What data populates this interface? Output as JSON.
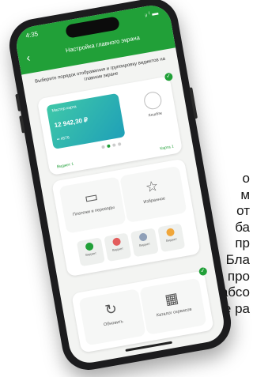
{
  "side_text": [
    "о",
    "м",
    "от",
    "ба",
    "пр",
    "Бла",
    "про",
    "абсо",
    "не ра"
  ],
  "status": {
    "time": "4:35",
    "indicators": "ᵢₗ ⁽ ▬"
  },
  "header": {
    "back_icon": "back-arrow-icon",
    "title": "Настройка главного экрана"
  },
  "subtitle": "Выберите порядок отображения и группировку виджетов на главном экране",
  "card_block": {
    "card_label": "Мастер карта",
    "card_amount": "12 942,30 ₽",
    "card_number": "•• 4576",
    "side_label": "Кешбэк",
    "foot_left": "Виджет 1",
    "foot_right": "Карта 1"
  },
  "tiles": [
    {
      "label": "Платежи и переводы",
      "icon": "card-icon"
    },
    {
      "label": "Избранное",
      "icon": "star-icon"
    }
  ],
  "minis": [
    {
      "label": "Виджет",
      "color": "#21a038"
    },
    {
      "label": "Виджет",
      "color": "#e35d5d"
    },
    {
      "label": "Виджет",
      "color": "#8fa0b8"
    },
    {
      "label": "Виджет",
      "color": "#f0a63a"
    }
  ],
  "bottom_tiles": [
    {
      "label": "Обновить",
      "icon": "refresh-icon"
    },
    {
      "label": "Каталог сервисов",
      "icon": "catalog-icon"
    }
  ],
  "colors": {
    "accent": "#21a038"
  }
}
